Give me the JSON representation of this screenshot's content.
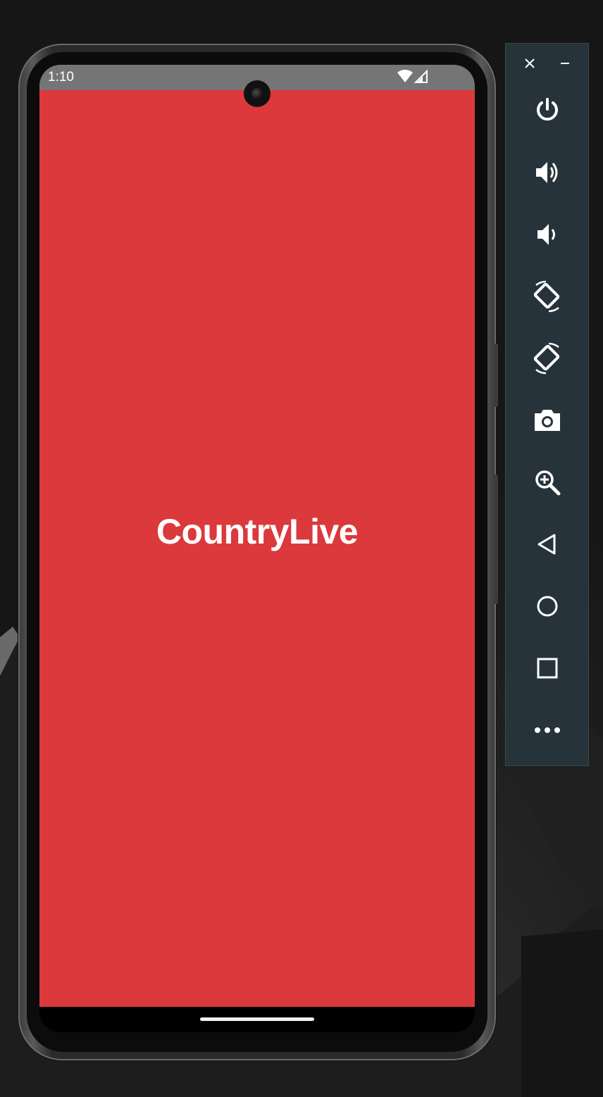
{
  "status_bar": {
    "time": "1:10",
    "icons": [
      "wifi-icon",
      "cellular-signal-icon"
    ]
  },
  "app": {
    "title": "CountryLive",
    "background_color": "#db393c",
    "title_color": "#ffffff"
  },
  "emulator_toolbar": {
    "window_controls": [
      "close-icon",
      "minimize-icon"
    ],
    "buttons": [
      "power-icon",
      "volume-up-icon",
      "volume-down-icon",
      "rotate-left-icon",
      "rotate-right-icon",
      "camera-icon",
      "zoom-icon",
      "back-icon",
      "home-icon",
      "overview-icon",
      "more-icon"
    ],
    "background_color": "#27333a"
  }
}
